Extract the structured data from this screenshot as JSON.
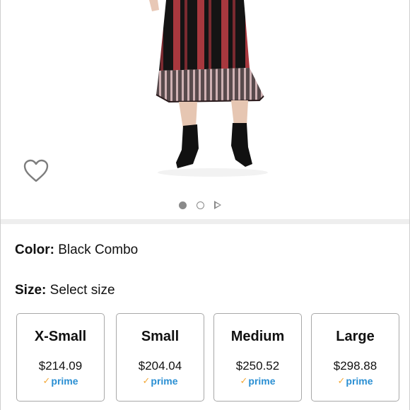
{
  "product": {
    "color_label": "Color:",
    "color_value": "Black Combo",
    "size_label": "Size:",
    "size_value": "Select size"
  },
  "gallery": {
    "dots": [
      "active",
      "inactive"
    ],
    "video_icon": "play-icon",
    "wishlist_icon": "heart-outline-icon"
  },
  "sizes": [
    {
      "name": "X-Small",
      "price": "$214.09",
      "badge": "prime"
    },
    {
      "name": "Small",
      "price": "$204.04",
      "badge": "prime"
    },
    {
      "name": "Medium",
      "price": "$250.52",
      "badge": "prime"
    },
    {
      "name": "Large",
      "price": "$298.88",
      "badge": "prime"
    }
  ],
  "colors": {
    "prime_blue": "#2a8fd3",
    "prime_check": "#f3a93a",
    "card_border": "#a8a8a8",
    "divider": "#eeeeee"
  }
}
